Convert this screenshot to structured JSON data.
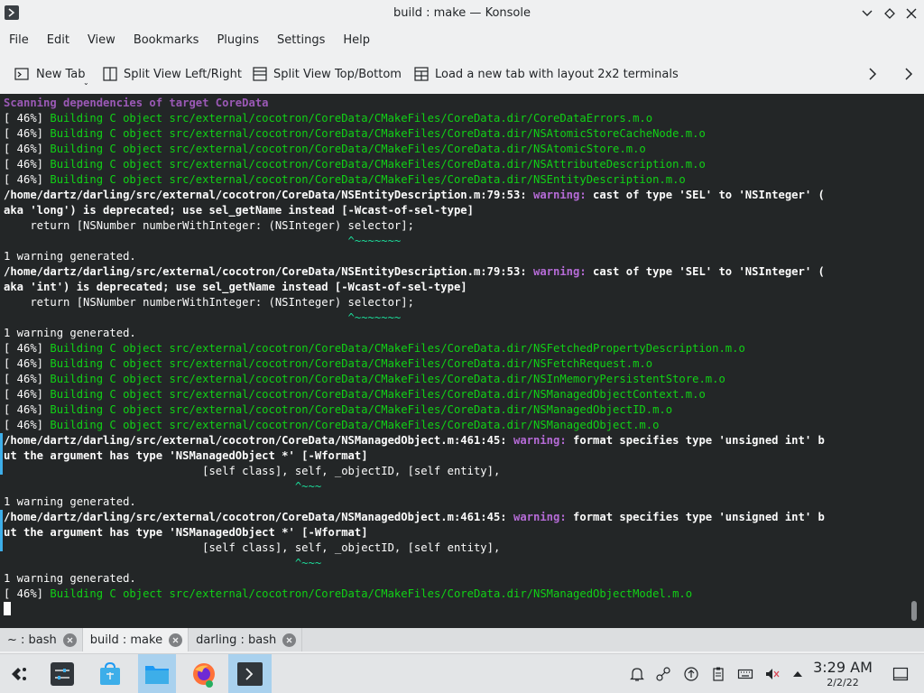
{
  "window": {
    "title": "build : make — Konsole"
  },
  "menu": [
    "File",
    "Edit",
    "View",
    "Bookmarks",
    "Plugins",
    "Settings",
    "Help"
  ],
  "toolbar": {
    "new_tab": "New Tab",
    "split_lr": "Split View Left/Right",
    "split_tb": "Split View Top/Bottom",
    "load_layout": "Load a new tab with layout 2x2 terminals"
  },
  "terminal": {
    "lines": [
      [
        {
          "t": "Scanning dependencies of target CoreData",
          "c": "c-purple"
        }
      ],
      [
        {
          "t": "[ 46%] ",
          "c": "c-white"
        },
        {
          "t": "Building C object src/external/cocotron/CoreData/CMakeFiles/CoreData.dir/CoreDataErrors.m.o",
          "c": "c-green2"
        }
      ],
      [
        {
          "t": "[ 46%] ",
          "c": "c-white"
        },
        {
          "t": "Building C object src/external/cocotron/CoreData/CMakeFiles/CoreData.dir/NSAtomicStoreCacheNode.m.o",
          "c": "c-green2"
        }
      ],
      [
        {
          "t": "[ 46%] ",
          "c": "c-white"
        },
        {
          "t": "Building C object src/external/cocotron/CoreData/CMakeFiles/CoreData.dir/NSAtomicStore.m.o",
          "c": "c-green2"
        }
      ],
      [
        {
          "t": "[ 46%] ",
          "c": "c-white"
        },
        {
          "t": "Building C object src/external/cocotron/CoreData/CMakeFiles/CoreData.dir/NSAttributeDescription.m.o",
          "c": "c-green2"
        }
      ],
      [
        {
          "t": "[ 46%] ",
          "c": "c-white"
        },
        {
          "t": "Building C object src/external/cocotron/CoreData/CMakeFiles/CoreData.dir/NSEntityDescription.m.o",
          "c": "c-green2"
        }
      ],
      [
        {
          "t": "/home/dartz/darling/src/external/cocotron/CoreData/NSEntityDescription.m:79:53: ",
          "c": "c-bold"
        },
        {
          "t": "warning: ",
          "c": "c-warn"
        },
        {
          "t": "cast of type 'SEL' to 'NSInteger' (",
          "c": "c-bold"
        }
      ],
      [
        {
          "t": "aka 'long') is deprecated; use sel_getName instead [-Wcast-of-sel-type]",
          "c": "c-bold"
        }
      ],
      [
        {
          "t": "    return [NSNumber numberWithInteger: (NSInteger) selector];",
          "c": "c-white"
        }
      ],
      [
        {
          "t": "                                                    ^~~~~~~~",
          "c": "c-caret"
        }
      ],
      [
        {
          "t": "1 warning generated.",
          "c": "c-white"
        }
      ],
      [
        {
          "t": "/home/dartz/darling/src/external/cocotron/CoreData/NSEntityDescription.m:79:53: ",
          "c": "c-bold"
        },
        {
          "t": "warning: ",
          "c": "c-warn"
        },
        {
          "t": "cast of type 'SEL' to 'NSInteger' (",
          "c": "c-bold"
        }
      ],
      [
        {
          "t": "aka 'int') is deprecated; use sel_getName instead [-Wcast-of-sel-type]",
          "c": "c-bold"
        }
      ],
      [
        {
          "t": "    return [NSNumber numberWithInteger: (NSInteger) selector];",
          "c": "c-white"
        }
      ],
      [
        {
          "t": "                                                    ^~~~~~~~",
          "c": "c-caret"
        }
      ],
      [
        {
          "t": "1 warning generated.",
          "c": "c-white"
        }
      ],
      [
        {
          "t": "[ 46%] ",
          "c": "c-white"
        },
        {
          "t": "Building C object src/external/cocotron/CoreData/CMakeFiles/CoreData.dir/NSFetchedPropertyDescription.m.o",
          "c": "c-green2"
        }
      ],
      [
        {
          "t": "[ 46%] ",
          "c": "c-white"
        },
        {
          "t": "Building C object src/external/cocotron/CoreData/CMakeFiles/CoreData.dir/NSFetchRequest.m.o",
          "c": "c-green2"
        }
      ],
      [
        {
          "t": "[ 46%] ",
          "c": "c-white"
        },
        {
          "t": "Building C object src/external/cocotron/CoreData/CMakeFiles/CoreData.dir/NSInMemoryPersistentStore.m.o",
          "c": "c-green2"
        }
      ],
      [
        {
          "t": "[ 46%] ",
          "c": "c-white"
        },
        {
          "t": "Building C object src/external/cocotron/CoreData/CMakeFiles/CoreData.dir/NSManagedObjectContext.m.o",
          "c": "c-green2"
        }
      ],
      [
        {
          "t": "[ 46%] ",
          "c": "c-white"
        },
        {
          "t": "Building C object src/external/cocotron/CoreData/CMakeFiles/CoreData.dir/NSManagedObjectID.m.o",
          "c": "c-green2"
        }
      ],
      [
        {
          "t": "[ 46%] ",
          "c": "c-white"
        },
        {
          "t": "Building C object src/external/cocotron/CoreData/CMakeFiles/CoreData.dir/NSManagedObject.m.o",
          "c": "c-green2"
        }
      ],
      [
        {
          "t": "/home/dartz/darling/src/external/cocotron/CoreData/NSManagedObject.m:461:45: ",
          "c": "c-bold"
        },
        {
          "t": "warning: ",
          "c": "c-warn"
        },
        {
          "t": "format specifies type 'unsigned int' b",
          "c": "c-bold"
        }
      ],
      [
        {
          "t": "ut the argument has type 'NSManagedObject *' [-Wformat]",
          "c": "c-bold"
        }
      ],
      [
        {
          "t": "                              [self class], self, _objectID, [self entity],",
          "c": "c-white"
        }
      ],
      [
        {
          "t": "                                            ^~~~",
          "c": "c-caret"
        }
      ],
      [
        {
          "t": "1 warning generated.",
          "c": "c-white"
        }
      ],
      [
        {
          "t": "/home/dartz/darling/src/external/cocotron/CoreData/NSManagedObject.m:461:45: ",
          "c": "c-bold"
        },
        {
          "t": "warning: ",
          "c": "c-warn"
        },
        {
          "t": "format specifies type 'unsigned int' b",
          "c": "c-bold"
        }
      ],
      [
        {
          "t": "ut the argument has type 'NSManagedObject *' [-Wformat]",
          "c": "c-bold"
        }
      ],
      [
        {
          "t": "                              [self class], self, _objectID, [self entity],",
          "c": "c-white"
        }
      ],
      [
        {
          "t": "                                            ^~~~",
          "c": "c-caret"
        }
      ],
      [
        {
          "t": "1 warning generated.",
          "c": "c-white"
        }
      ],
      [
        {
          "t": "[ 46%] ",
          "c": "c-white"
        },
        {
          "t": "Building C object src/external/cocotron/CoreData/CMakeFiles/CoreData.dir/NSManagedObjectModel.m.o",
          "c": "c-green2"
        }
      ]
    ]
  },
  "tabs": [
    {
      "label": "~ : bash"
    },
    {
      "label": "build : make"
    },
    {
      "label": "darling : bash"
    }
  ],
  "clock": {
    "time": "3:29 AM",
    "date": "2/2/22"
  },
  "colors": {
    "terminal_bg": "#232627",
    "accent": "#3daee9",
    "green": "#11d116",
    "warning": "#b56bd6"
  }
}
